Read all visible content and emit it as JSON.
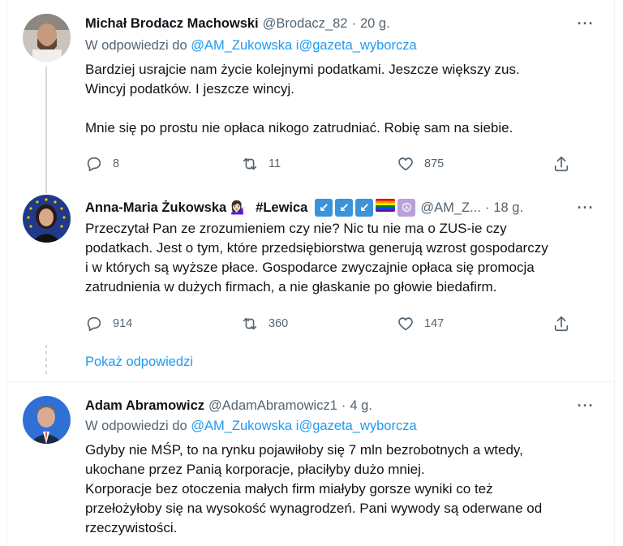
{
  "tweets": [
    {
      "author": "Michał Brodacz Machowski",
      "handle": "@Brodacz_82",
      "separator": "·",
      "time": "20 g.",
      "more": "···",
      "reply_prefix": "W odpowiedzi do",
      "reply_user1": "@AM_Zukowska",
      "reply_and": "i",
      "reply_user2": "@gazeta_wyborcza",
      "text_lines": [
        "Bardziej usrajcie nam życie kolejnymi podatkami. Jeszcze większy zus.",
        "Wincyj podatków. I jeszcze wincyj.",
        "",
        "Mnie się po prostu nie opłaca nikogo zatrudniać. Robię sam na siebie."
      ],
      "replies": "8",
      "retweets": "11",
      "likes": "875",
      "avatar_color": "#b9b2a8"
    },
    {
      "author": "Anna-Maria Żukowska",
      "emoji": "💁🏻‍♀️",
      "hashtag": "#Lewica",
      "badges": [
        "↙",
        "↙",
        "↙"
      ],
      "peace": "☮",
      "handle": "@AM_Z...",
      "separator": "·",
      "time": "18 g.",
      "more": "···",
      "text_lines": [
        "Przeczytał Pan ze zrozumieniem czy nie? Nic tu nie ma o ZUS-ie czy",
        "podatkach. Jest o tym, które przedsiębiorstwa generują wzrost gospodarczy",
        "i w których są wyższe płace. Gospodarce zwyczajnie opłaca się promocja",
        "zatrudnienia w dużych firmach, a nie głaskanie po głowie biedafirm."
      ],
      "replies": "914",
      "retweets": "360",
      "likes": "147",
      "avatar_color": "#1f3a8a"
    },
    {
      "author": "Adam Abramowicz",
      "handle": "@AdamAbramowicz1",
      "separator": "·",
      "time": "4 g.",
      "more": "···",
      "reply_prefix": "W odpowiedzi do",
      "reply_user1": "@AM_Zukowska",
      "reply_and": "i",
      "reply_user2": "@gazeta_wyborcza",
      "text_lines": [
        "Gdyby nie MŚP, to na rynku pojawiłoby się 7 mln bezrobotnych a wtedy,",
        "ukochane przez Panią korporacje, płaciłyby dużo mniej.",
        "Korporacje bez otoczenia małych firm miałyby gorsze wyniki co też",
        "przełożyłoby się na wysokość  wynagrodzeń. Pani wywody są oderwane od",
        "rzeczywistości."
      ],
      "avatar_color": "#2f6fd6"
    }
  ],
  "show_replies": "Pokaż odpowiedzi",
  "colors": {
    "link": "#1d9bf0",
    "secondary": "#536471",
    "thread_line": "#cfd9de"
  }
}
